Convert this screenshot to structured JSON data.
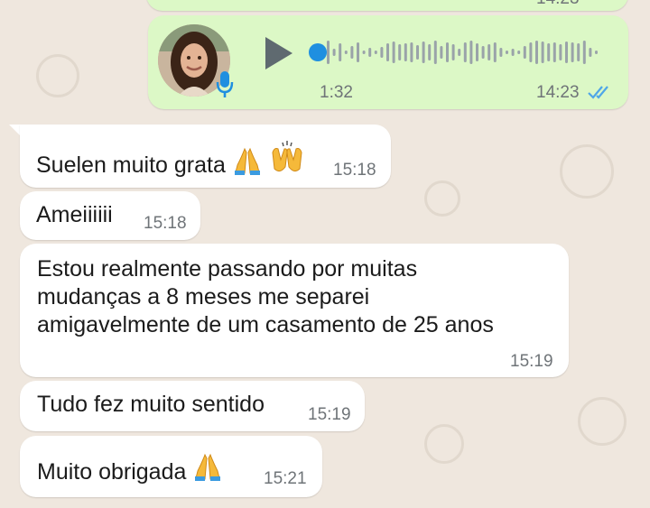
{
  "prev_message": {
    "time_partial": "14:23"
  },
  "voice_message": {
    "duration": "1:32",
    "time": "14:23",
    "status_icon": "double-check-read-icon",
    "avatar_icon": "contact-avatar",
    "mic_icon": "microphone-icon",
    "play_icon": "play-icon",
    "progress": 0.0,
    "colors": {
      "bubble": "#dcf8c6",
      "accent": "#1f8fe0",
      "wave": "#9aa3a9",
      "read_check": "#4fa6e8"
    }
  },
  "messages": [
    {
      "text": "Suelen muito grata",
      "emoji": [
        "folded-hands",
        "raising-hands"
      ],
      "time": "15:18"
    },
    {
      "text": "Ameiiiiii",
      "emoji": [],
      "time": "15:18"
    },
    {
      "lines": [
        "Estou realmente passando por muitas",
        "mudanças a 8 meses me separei",
        "amigavelmente de um casamento de 25 anos"
      ],
      "time": "15:19"
    },
    {
      "text": "Tudo fez muito sentido",
      "emoji": [],
      "time": "15:19"
    },
    {
      "text": "Muito obrigada",
      "emoji": [
        "folded-hands"
      ],
      "time": "15:21"
    }
  ]
}
